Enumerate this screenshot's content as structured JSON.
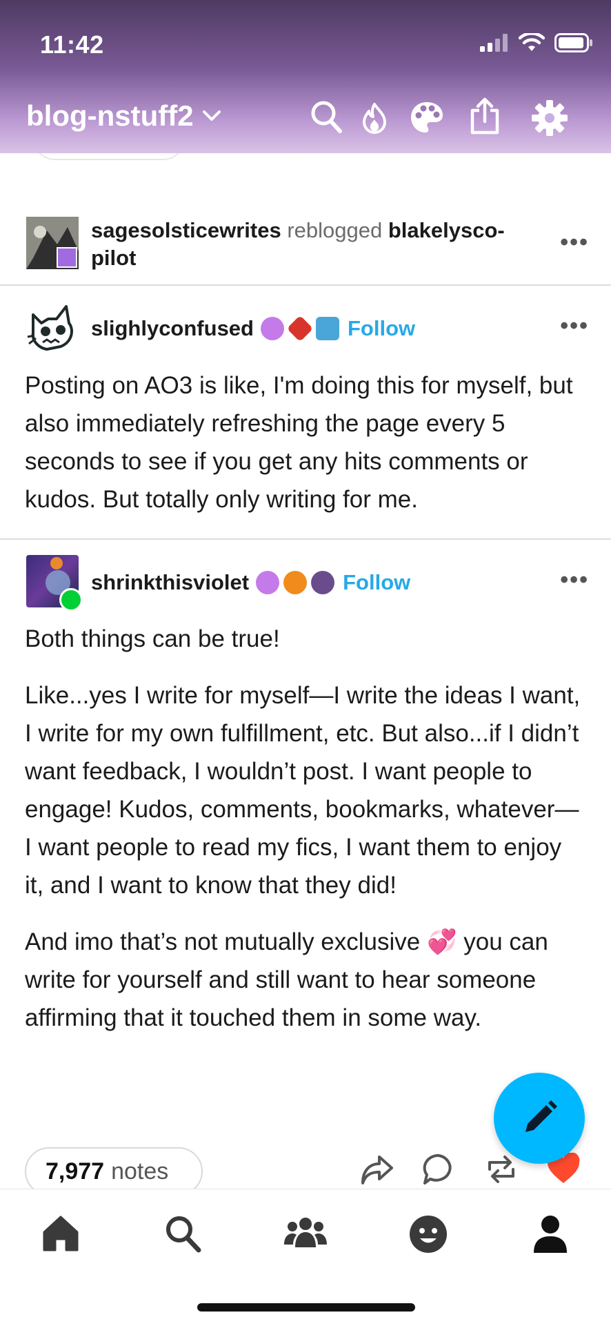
{
  "status_bar": {
    "time": "11:42"
  },
  "header": {
    "blog_name": "blog-nstuff2",
    "icons": [
      "chevron-down-icon",
      "search-icon",
      "flame-icon",
      "palette-icon",
      "share-icon",
      "gear-icon"
    ]
  },
  "reblog_header": {
    "reblogger": "sagesolsticewrites",
    "verb": "reblogged",
    "original": "blakelysco-pilot"
  },
  "post1": {
    "username": "slighlyconfused",
    "follow_label": "Follow",
    "text": "Posting on AO3 is like, I'm doing this for myself, but also immediately refreshing the page every 5 seconds to see if you get any hits comments or kudos. But totally only writing for me."
  },
  "post2": {
    "username": "shrinkthisviolet",
    "follow_label": "Follow",
    "paragraphs": [
      "Both things can be true!",
      "Like...yes I write for myself—I write the ideas I want, I write for my own fulfillment, etc. But also...if I didn’t want feedback, I wouldn’t post. I want people to engage! Kudos, comments, bookmarks, whatever—I want people to read my fics, I want them to enjoy it, and I want to know that they did!",
      "And imo that’s not mutually exclusive 💞 you can write for yourself and still want to hear someone affirming that it touched them in some way."
    ]
  },
  "notes": {
    "count": "7,977",
    "label": "notes"
  },
  "actions": [
    "share-icon",
    "reply-icon",
    "reblog-icon",
    "like-icon"
  ],
  "tabbar": [
    "home-icon",
    "search-icon",
    "community-icon",
    "activity-icon",
    "account-icon"
  ],
  "colors": {
    "accent": "#00b8ff",
    "follow": "#27a9e8",
    "like": "#ff492f"
  }
}
